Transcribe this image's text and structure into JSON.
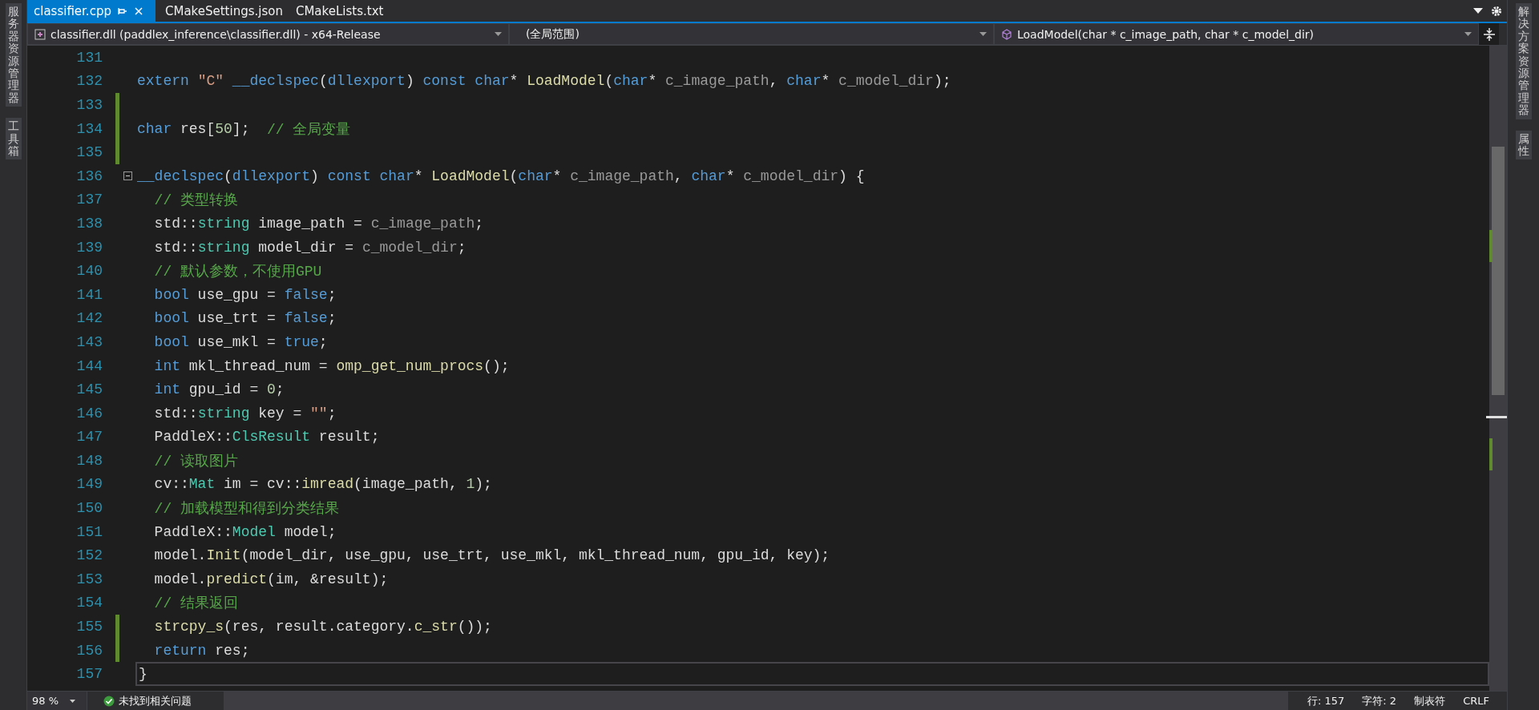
{
  "left_strip": {
    "items": [
      "服务器资源管理器",
      "工具箱"
    ]
  },
  "tabs": [
    {
      "label": "classifier.cpp",
      "selected": true
    },
    {
      "label": "CMakeSettings.json",
      "selected": false
    },
    {
      "label": "CMakeLists.txt",
      "selected": false
    }
  ],
  "nav_bar": {
    "project": "classifier.dll (paddlex_inference\\classifier.dll) - x64-Release",
    "scope": "(全局范围)",
    "member": "LoadModel(char * c_image_path, char * c_model_dir)"
  },
  "editor": {
    "lines": [
      {
        "number": "131",
        "changed": false,
        "current": false
      },
      {
        "number": "132",
        "changed": false,
        "current": false,
        "tokens": [
          {
            "kind": "keyword",
            "text": "extern "
          },
          {
            "kind": "string",
            "text": "\"C\" "
          },
          {
            "kind": "keyword",
            "text": "__declspec"
          },
          {
            "kind": "plain",
            "text": "("
          },
          {
            "kind": "keyword",
            "text": "dllexport"
          },
          {
            "kind": "plain",
            "text": ") "
          },
          {
            "kind": "keyword",
            "text": "const char"
          },
          {
            "kind": "plain",
            "text": "* "
          },
          {
            "kind": "function",
            "text": "LoadModel"
          },
          {
            "kind": "plain",
            "text": "("
          },
          {
            "kind": "keyword",
            "text": "char"
          },
          {
            "kind": "plain",
            "text": "* "
          },
          {
            "kind": "param",
            "text": "c_image_path"
          },
          {
            "kind": "plain",
            "text": ", "
          },
          {
            "kind": "keyword",
            "text": "char"
          },
          {
            "kind": "plain",
            "text": "* "
          },
          {
            "kind": "param",
            "text": "c_model_dir"
          },
          {
            "kind": "plain",
            "text": ");"
          }
        ]
      },
      {
        "number": "133",
        "changed": true,
        "current": false
      },
      {
        "number": "134",
        "changed": true,
        "current": false,
        "tokens": [
          {
            "kind": "keyword",
            "text": "char"
          },
          {
            "kind": "plain",
            "text": " res["
          },
          {
            "kind": "number",
            "text": "50"
          },
          {
            "kind": "plain",
            "text": "];  "
          },
          {
            "kind": "comment",
            "text": "// 全局变量"
          }
        ]
      },
      {
        "number": "135",
        "changed": true,
        "current": false
      },
      {
        "number": "136",
        "changed": false,
        "current": false,
        "expanded": true,
        "tokens": [
          {
            "kind": "keyword",
            "text": "__declspec"
          },
          {
            "kind": "plain",
            "text": "("
          },
          {
            "kind": "keyword",
            "text": "dllexport"
          },
          {
            "kind": "plain",
            "text": ") "
          },
          {
            "kind": "keyword",
            "text": "const char"
          },
          {
            "kind": "plain",
            "text": "* "
          },
          {
            "kind": "function",
            "text": "LoadModel"
          },
          {
            "kind": "plain",
            "text": "("
          },
          {
            "kind": "keyword",
            "text": "char"
          },
          {
            "kind": "plain",
            "text": "* "
          },
          {
            "kind": "param",
            "text": "c_image_path"
          },
          {
            "kind": "plain",
            "text": ", "
          },
          {
            "kind": "keyword",
            "text": "char"
          },
          {
            "kind": "plain",
            "text": "* "
          },
          {
            "kind": "param",
            "text": "c_model_dir"
          },
          {
            "kind": "plain",
            "text": ") {"
          }
        ]
      },
      {
        "number": "137",
        "changed": false,
        "current": false,
        "tokens": [
          {
            "kind": "comment",
            "text": "  // 类型转换"
          }
        ]
      },
      {
        "number": "138",
        "changed": false,
        "current": false,
        "tokens": [
          {
            "kind": "plain",
            "text": "  std::"
          },
          {
            "kind": "type",
            "text": "string"
          },
          {
            "kind": "plain",
            "text": " image_path = "
          },
          {
            "kind": "param",
            "text": "c_image_path"
          },
          {
            "kind": "plain",
            "text": ";"
          }
        ]
      },
      {
        "number": "139",
        "changed": false,
        "current": false,
        "tokens": [
          {
            "kind": "plain",
            "text": "  std::"
          },
          {
            "kind": "type",
            "text": "string"
          },
          {
            "kind": "plain",
            "text": " model_dir = "
          },
          {
            "kind": "param",
            "text": "c_model_dir"
          },
          {
            "kind": "plain",
            "text": ";"
          }
        ]
      },
      {
        "number": "140",
        "changed": false,
        "current": false,
        "tokens": [
          {
            "kind": "comment",
            "text": "  // 默认参数，不使用GPU"
          }
        ]
      },
      {
        "number": "141",
        "changed": false,
        "current": false,
        "tokens": [
          {
            "kind": "keyword",
            "text": "  bool"
          },
          {
            "kind": "plain",
            "text": " use_gpu = "
          },
          {
            "kind": "keyword",
            "text": "false"
          },
          {
            "kind": "plain",
            "text": ";"
          }
        ]
      },
      {
        "number": "142",
        "changed": false,
        "current": false,
        "tokens": [
          {
            "kind": "keyword",
            "text": "  bool"
          },
          {
            "kind": "plain",
            "text": " use_trt = "
          },
          {
            "kind": "keyword",
            "text": "false"
          },
          {
            "kind": "plain",
            "text": ";"
          }
        ]
      },
      {
        "number": "143",
        "changed": false,
        "current": false,
        "tokens": [
          {
            "kind": "keyword",
            "text": "  bool"
          },
          {
            "kind": "plain",
            "text": " use_mkl = "
          },
          {
            "kind": "keyword",
            "text": "true"
          },
          {
            "kind": "plain",
            "text": ";"
          }
        ]
      },
      {
        "number": "144",
        "changed": false,
        "current": false,
        "tokens": [
          {
            "kind": "keyword",
            "text": "  int"
          },
          {
            "kind": "plain",
            "text": " mkl_thread_num = "
          },
          {
            "kind": "function",
            "text": "omp_get_num_procs"
          },
          {
            "kind": "plain",
            "text": "();"
          }
        ]
      },
      {
        "number": "145",
        "changed": false,
        "current": false,
        "tokens": [
          {
            "kind": "keyword",
            "text": "  int"
          },
          {
            "kind": "plain",
            "text": " gpu_id = "
          },
          {
            "kind": "number",
            "text": "0"
          },
          {
            "kind": "plain",
            "text": ";"
          }
        ]
      },
      {
        "number": "146",
        "changed": false,
        "current": false,
        "tokens": [
          {
            "kind": "plain",
            "text": "  std::"
          },
          {
            "kind": "type",
            "text": "string"
          },
          {
            "kind": "plain",
            "text": " key = "
          },
          {
            "kind": "string",
            "text": "\"\""
          },
          {
            "kind": "plain",
            "text": ";"
          }
        ]
      },
      {
        "number": "147",
        "changed": false,
        "current": false,
        "tokens": [
          {
            "kind": "plain",
            "text": "  PaddleX::"
          },
          {
            "kind": "type",
            "text": "ClsResult"
          },
          {
            "kind": "plain",
            "text": " result;"
          }
        ]
      },
      {
        "number": "148",
        "changed": false,
        "current": false,
        "tokens": [
          {
            "kind": "comment",
            "text": "  // 读取图片"
          }
        ]
      },
      {
        "number": "149",
        "changed": false,
        "current": false,
        "tokens": [
          {
            "kind": "plain",
            "text": "  cv::"
          },
          {
            "kind": "type",
            "text": "Mat"
          },
          {
            "kind": "plain",
            "text": " im = cv::"
          },
          {
            "kind": "function",
            "text": "imread"
          },
          {
            "kind": "plain",
            "text": "(image_path, "
          },
          {
            "kind": "number",
            "text": "1"
          },
          {
            "kind": "plain",
            "text": ");"
          }
        ]
      },
      {
        "number": "150",
        "changed": false,
        "current": false,
        "tokens": [
          {
            "kind": "comment",
            "text": "  // 加载模型和得到分类结果"
          }
        ]
      },
      {
        "number": "151",
        "changed": false,
        "current": false,
        "tokens": [
          {
            "kind": "plain",
            "text": "  PaddleX::"
          },
          {
            "kind": "type",
            "text": "Model"
          },
          {
            "kind": "plain",
            "text": " model;"
          }
        ]
      },
      {
        "number": "152",
        "changed": false,
        "current": false,
        "tokens": [
          {
            "kind": "plain",
            "text": "  model."
          },
          {
            "kind": "function",
            "text": "Init"
          },
          {
            "kind": "plain",
            "text": "(model_dir, use_gpu, use_trt, use_mkl, mkl_thread_num, gpu_id, key);"
          }
        ]
      },
      {
        "number": "153",
        "changed": false,
        "current": false,
        "tokens": [
          {
            "kind": "plain",
            "text": "  model."
          },
          {
            "kind": "function",
            "text": "predict"
          },
          {
            "kind": "plain",
            "text": "(im, &result);"
          }
        ]
      },
      {
        "number": "154",
        "changed": false,
        "current": false,
        "tokens": [
          {
            "kind": "comment",
            "text": "  // 结果返回"
          }
        ]
      },
      {
        "number": "155",
        "changed": true,
        "current": false,
        "tokens": [
          {
            "kind": "function",
            "text": "  strcpy_s"
          },
          {
            "kind": "plain",
            "text": "(res, result.category."
          },
          {
            "kind": "function",
            "text": "c_str"
          },
          {
            "kind": "plain",
            "text": "());"
          }
        ]
      },
      {
        "number": "156",
        "changed": true,
        "current": false,
        "tokens": [
          {
            "kind": "keyword",
            "text": "  return"
          },
          {
            "kind": "plain",
            "text": " res;"
          }
        ]
      },
      {
        "number": "157",
        "changed": false,
        "current": true,
        "tokens": [
          {
            "kind": "plain",
            "text": "}"
          }
        ]
      }
    ]
  },
  "footer": {
    "zoom": "98 %",
    "issues": "未找到相关问题",
    "line": "行: 157",
    "char": "字符: 2",
    "indent": "制表符",
    "line_ending": "CRLF"
  },
  "right_strip": {
    "items": [
      "解决方案资源管理器",
      "属性"
    ]
  }
}
